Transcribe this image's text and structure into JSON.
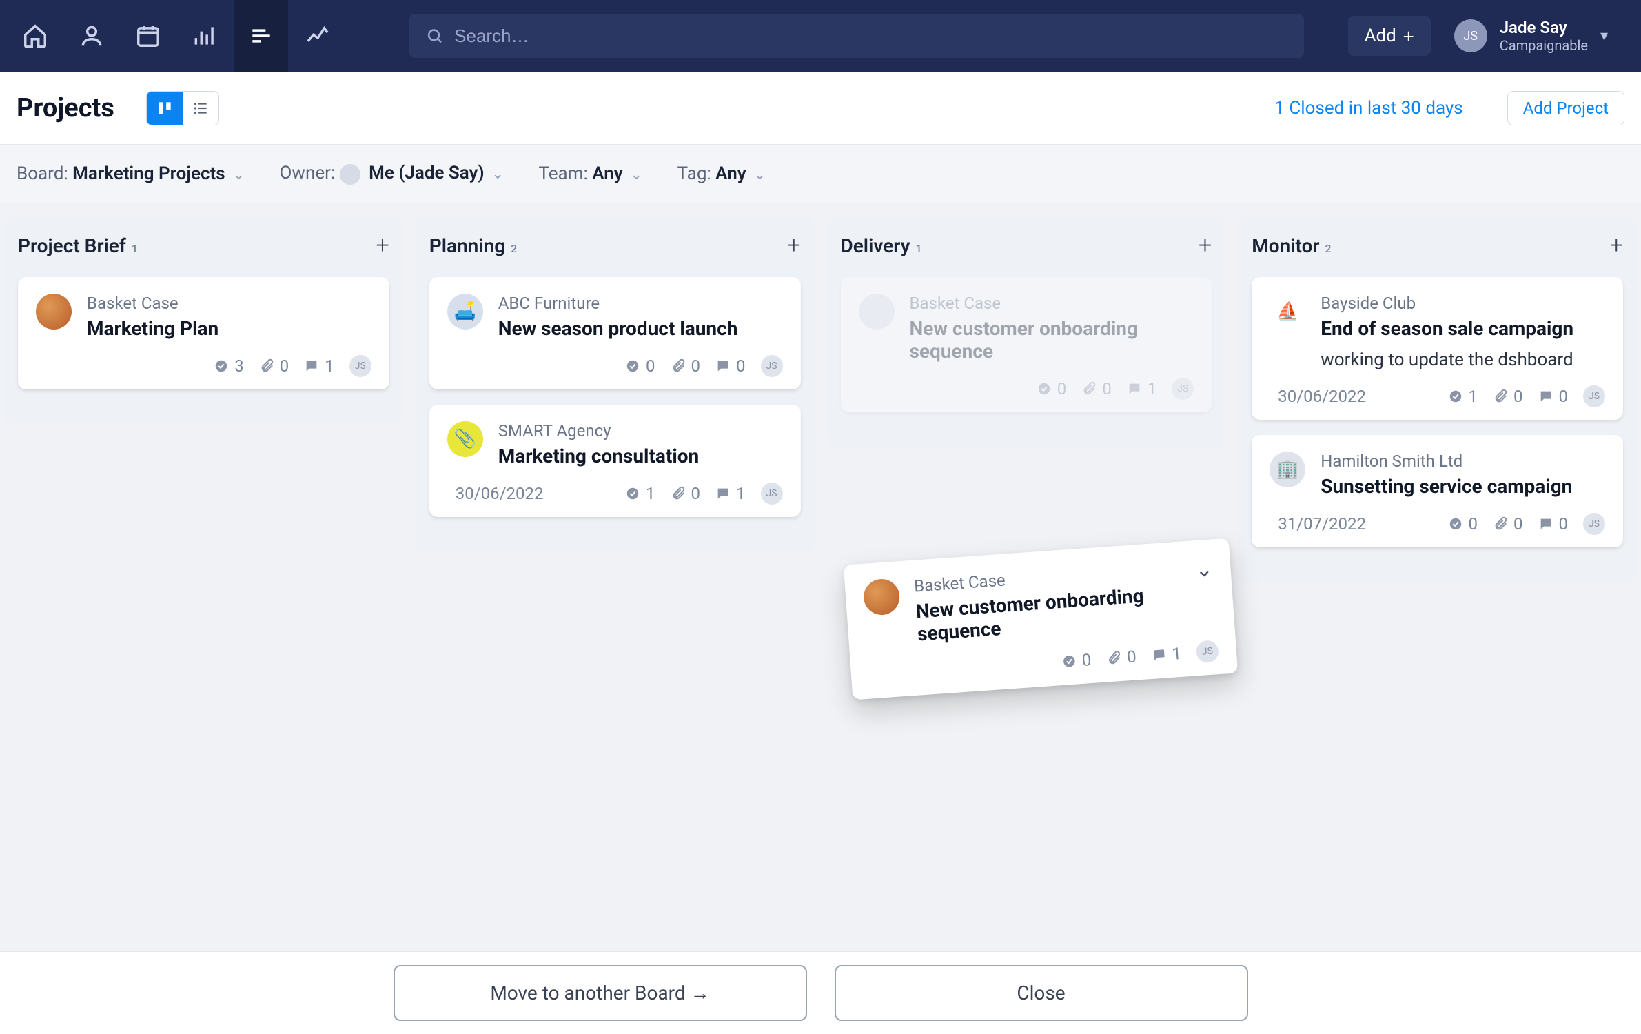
{
  "nav": {
    "search_placeholder": "Search…",
    "add_label": "Add",
    "user": {
      "initials": "JS",
      "name": "Jade Say",
      "org": "Campaignable"
    }
  },
  "header": {
    "title": "Projects",
    "closed_link": "1 Closed in last 30 days",
    "add_project": "Add Project"
  },
  "filters": {
    "board_label": "Board:",
    "board_value": "Marketing Projects",
    "owner_label": "Owner:",
    "owner_value": "Me (Jade Say)",
    "team_label": "Team:",
    "team_value": "Any",
    "tag_label": "Tag:",
    "tag_value": "Any"
  },
  "columns": [
    {
      "title": "Project Brief",
      "count": "1",
      "cards": [
        {
          "client": "Basket Case",
          "title": "Marketing Plan",
          "dot_style": "background:radial-gradient(circle at 35% 35%, #e09a55, #b85c2a);",
          "note": null,
          "date": null,
          "checks": "3",
          "attachments": "0",
          "comments": "1",
          "ghost": false
        }
      ]
    },
    {
      "title": "Planning",
      "count": "2",
      "cards": [
        {
          "client": "ABC Furniture",
          "title": "New season product launch",
          "dot_style": "background:#d7dfec;",
          "dot_emoji": "🛋️",
          "note": null,
          "date": null,
          "checks": "0",
          "attachments": "0",
          "comments": "0",
          "ghost": false
        },
        {
          "client": "SMART Agency",
          "title": "Marketing consultation",
          "dot_style": "background:#e9e63a;",
          "dot_emoji": "📎",
          "note": null,
          "date": "30/06/2022",
          "checks": "1",
          "attachments": "0",
          "comments": "1",
          "ghost": false
        }
      ]
    },
    {
      "title": "Delivery",
      "count": "1",
      "cards": [
        {
          "client": "Basket Case",
          "title": "New customer onboarding sequence",
          "dot_style": "background:#dfe3eb;",
          "note": null,
          "date": null,
          "checks": "0",
          "attachments": "0",
          "comments": "1",
          "ghost": true
        }
      ]
    },
    {
      "title": "Monitor",
      "count": "2",
      "cards": [
        {
          "client": "Bayside Club",
          "title": "End of season sale campaign",
          "dot_style": "background:#fff;",
          "dot_emoji": "⛵",
          "note": "working to update the dshboard",
          "date": "30/06/2022",
          "checks": "1",
          "attachments": "0",
          "comments": "0",
          "ghost": false
        },
        {
          "client": "Hamilton Smith Ltd",
          "title": "Sunsetting service campaign",
          "dot_style": "background:#dfe3eb;",
          "dot_emoji": "🏢",
          "note": null,
          "date": "31/07/2022",
          "checks": "0",
          "attachments": "0",
          "comments": "0",
          "ghost": false
        }
      ]
    }
  ],
  "drag_card": {
    "client": "Basket Case",
    "title": "New customer onboarding sequence",
    "dot_style": "background:radial-gradient(circle at 35% 35%, #e09a55, #b85c2a);",
    "checks": "0",
    "attachments": "0",
    "comments": "1"
  },
  "bottom": {
    "move_label": "Move to another Board →",
    "close_label": "Close"
  }
}
